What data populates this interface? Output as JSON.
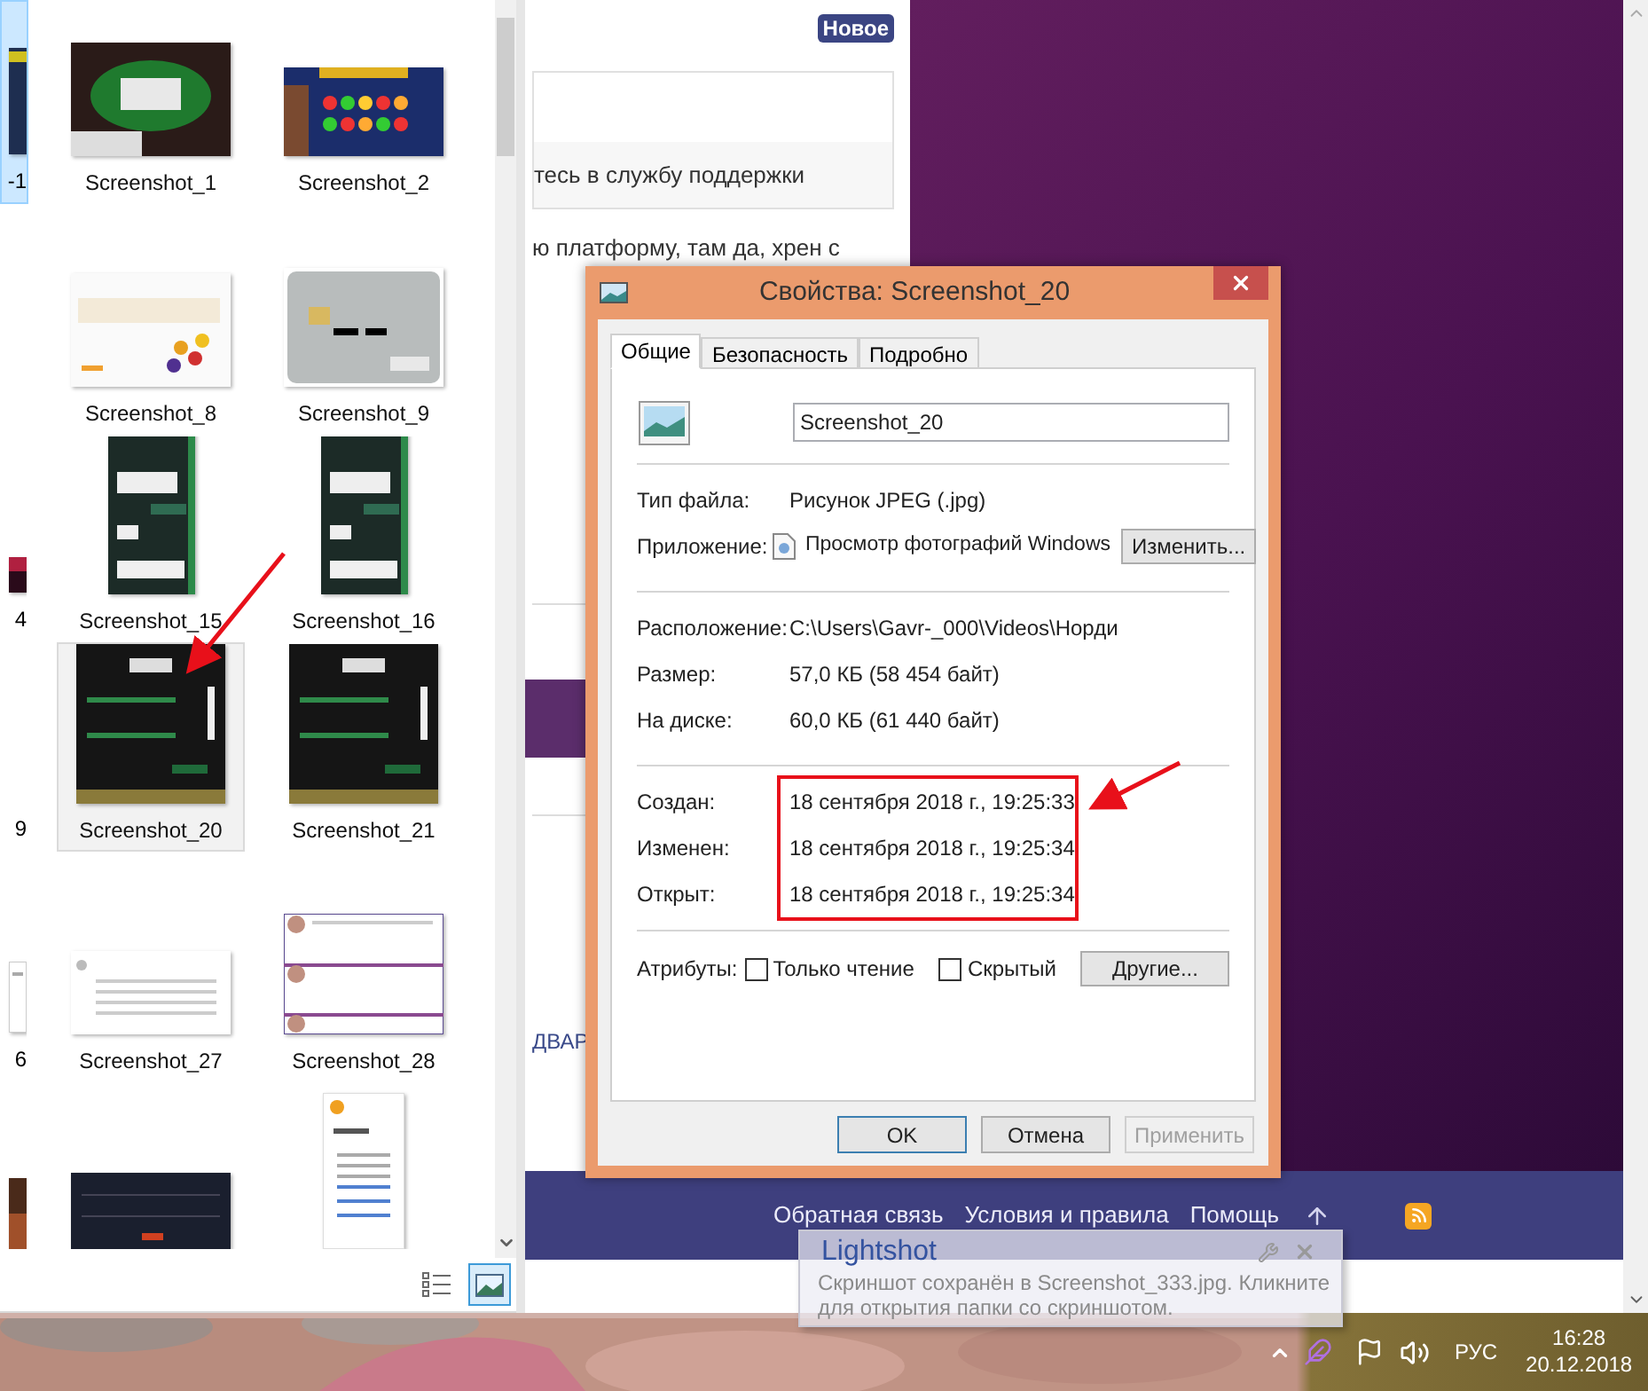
{
  "explorer": {
    "rows": [
      {
        "partial": {
          "label": "-1",
          "selected": true,
          "hovered": false
        },
        "items": [
          {
            "label": "Screenshot_1",
            "selected": false,
            "hovered": false
          },
          {
            "label": "Screenshot_2",
            "selected": false,
            "hovered": false
          }
        ]
      },
      {
        "items": [
          {
            "label": "Screenshot_8",
            "selected": false,
            "hovered": false
          },
          {
            "label": "Screenshot_9",
            "selected": false,
            "hovered": false
          }
        ]
      },
      {
        "partial": {
          "label": "4",
          "selected": false,
          "hovered": false
        },
        "items": [
          {
            "label": "Screenshot_15",
            "selected": false,
            "hovered": false
          },
          {
            "label": "Screenshot_16",
            "selected": false,
            "hovered": false
          }
        ]
      },
      {
        "partial": {
          "label": "9",
          "selected": false,
          "hovered": false
        },
        "items": [
          {
            "label": "Screenshot_20",
            "selected": false,
            "hovered": true
          },
          {
            "label": "Screenshot_21",
            "selected": false,
            "hovered": false
          }
        ]
      },
      {
        "partial": {
          "label": "6",
          "selected": false,
          "hovered": false
        },
        "items": [
          {
            "label": "Screenshot_27",
            "selected": false,
            "hovered": false
          },
          {
            "label": "Screenshot_28",
            "selected": false,
            "hovered": false
          }
        ]
      },
      {
        "partial": {
          "selected": false,
          "hovered": false
        },
        "items": [
          {
            "selected": false,
            "hovered": false
          },
          {
            "selected": false,
            "hovered": false
          }
        ]
      }
    ],
    "view_buttons": [
      {
        "kind": "details",
        "selected": false
      },
      {
        "kind": "thumbnails",
        "selected": true
      }
    ]
  },
  "browser": {
    "badge": "Новое",
    "support_text": "тесь в службу поддержки",
    "body_text": "ю платформу, там да, хрен с",
    "link_fragment": "ДВАР",
    "footer_links": [
      "Обратная связь",
      "Условия и правила",
      "Помощь"
    ]
  },
  "dialog": {
    "title": "Свойства: Screenshot_20",
    "tabs": [
      {
        "label": "Общие",
        "selected": true
      },
      {
        "label": "Безопасность",
        "selected": false
      },
      {
        "label": "Подробно",
        "selected": false
      }
    ],
    "file_name": "Screenshot_20",
    "sections": [
      {
        "annotated": false,
        "rows": [
          {
            "kind": "text",
            "label": "Тип файла:",
            "value": "Рисунок JPEG (.jpg)"
          },
          {
            "kind": "app",
            "label": "Приложение:",
            "value": "Просмотр фотографий Windows",
            "button": "Изменить..."
          }
        ]
      },
      {
        "annotated": false,
        "rows": [
          {
            "kind": "text",
            "label": "Расположение:",
            "value": "C:\\Users\\Gavr-_000\\Videos\\Норди"
          },
          {
            "kind": "text",
            "label": "Размер:",
            "value": "57,0 КБ (58 454 байт)"
          },
          {
            "kind": "text",
            "label": "На диске:",
            "value": "60,0 КБ (61 440 байт)"
          }
        ]
      },
      {
        "annotated": true,
        "rows": [
          {
            "kind": "text",
            "label": "Создан:",
            "value": "18 сентября 2018 г., 19:25:33"
          },
          {
            "kind": "text",
            "label": "Изменен:",
            "value": "18 сентября 2018 г., 19:25:34"
          },
          {
            "kind": "text",
            "label": "Открыт:",
            "value": "18 сентября 2018 г., 19:25:34"
          }
        ]
      }
    ],
    "attributes": {
      "label": "Атрибуты:",
      "checks": [
        {
          "label": "Только чтение",
          "checked": false
        },
        {
          "label": "Скрытый",
          "checked": false
        }
      ],
      "button": "Другие..."
    },
    "buttons": [
      {
        "label": "OK",
        "default": true,
        "disabled": false
      },
      {
        "label": "Отмена",
        "default": false,
        "disabled": false
      },
      {
        "label": "Применить",
        "default": false,
        "disabled": true
      }
    ]
  },
  "notification": {
    "title": "Lightshot",
    "text": "Скриншот сохранён в Screenshot_333.jpg. Кликните для открытия папки со скриншотом."
  },
  "tray": {
    "language": "РУС",
    "time": "16:28",
    "date": "20.12.2018"
  }
}
